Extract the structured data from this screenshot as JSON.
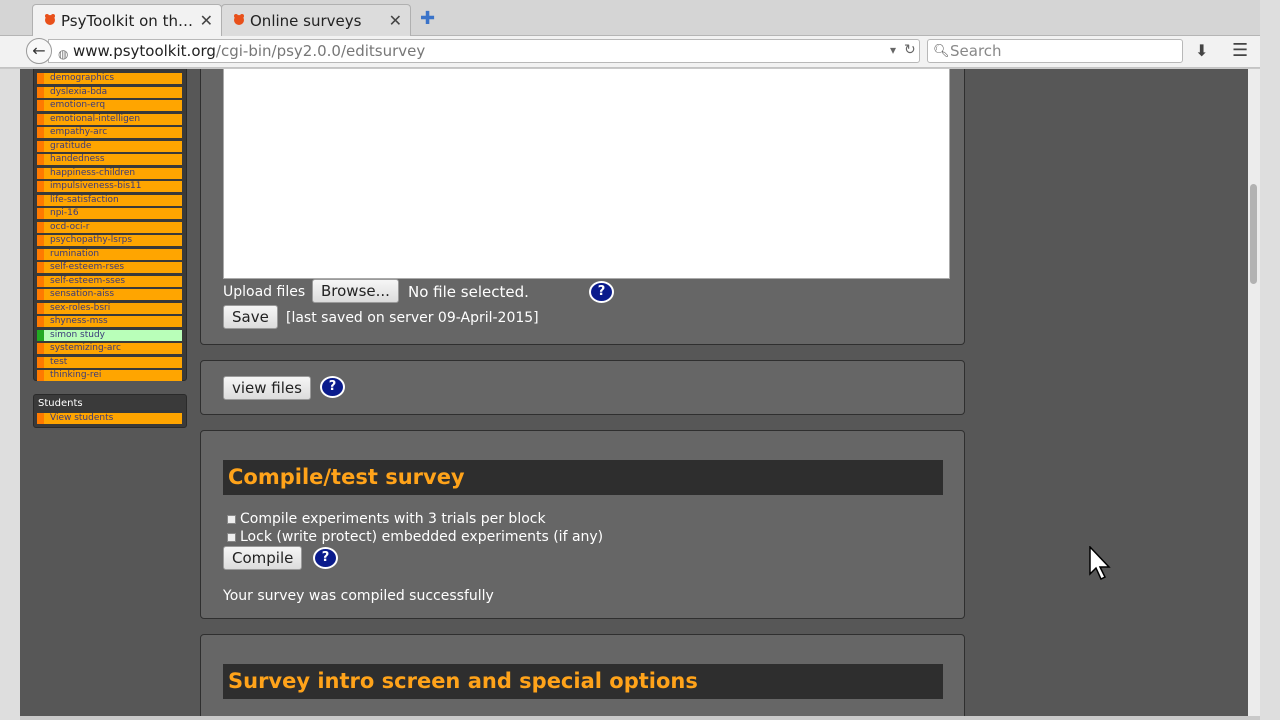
{
  "browser": {
    "tabs": [
      {
        "title": "PsyToolkit on th…",
        "active": true
      },
      {
        "title": "Online surveys",
        "active": false
      }
    ],
    "url_host": "www.psytoolkit.org",
    "url_path": "/cgi-bin/psy2.0.0/editsurvey",
    "search_placeholder": "Search"
  },
  "sidebar": {
    "surveys": [
      "demographics",
      "dyslexia-bda",
      "emotion-erq",
      "emotional-intelligen",
      "empathy-arc",
      "gratitude",
      "handedness",
      "happiness-children",
      "impulsiveness-bis11",
      "life-satisfaction",
      "npi-16",
      "ocd-oci-r",
      "psychopathy-lsrps",
      "rumination",
      "self-esteem-rses",
      "self-esteem-sses",
      "sensation-aiss",
      "sex-roles-bsri",
      "shyness-mss",
      "simon study",
      "systemizing-arc",
      "test",
      "thinking-rei"
    ],
    "selected": "simon study",
    "students_title": "Students",
    "students_link": "View students"
  },
  "editor": {
    "upload_label": "Upload files",
    "browse_label": "Browse...",
    "no_file": "No file selected.",
    "save_label": "Save",
    "last_saved": "[last saved on server 09-April-2015]"
  },
  "files": {
    "view_label": "view files"
  },
  "compile": {
    "title": "Compile/test survey",
    "option1": "Compile experiments with 3 trials per block",
    "option2": "Lock (write protect) embedded experiments (if any)",
    "compile_label": "Compile",
    "status": "Your survey was compiled successfully"
  },
  "intro": {
    "title": "Survey intro screen and special options"
  },
  "help_glyph": "?",
  "colors": {
    "accent": "#ffa31a",
    "link_bg": "#ffa500",
    "selected_bg": "#b9ffb9",
    "help_bg": "#0a1b8c"
  }
}
